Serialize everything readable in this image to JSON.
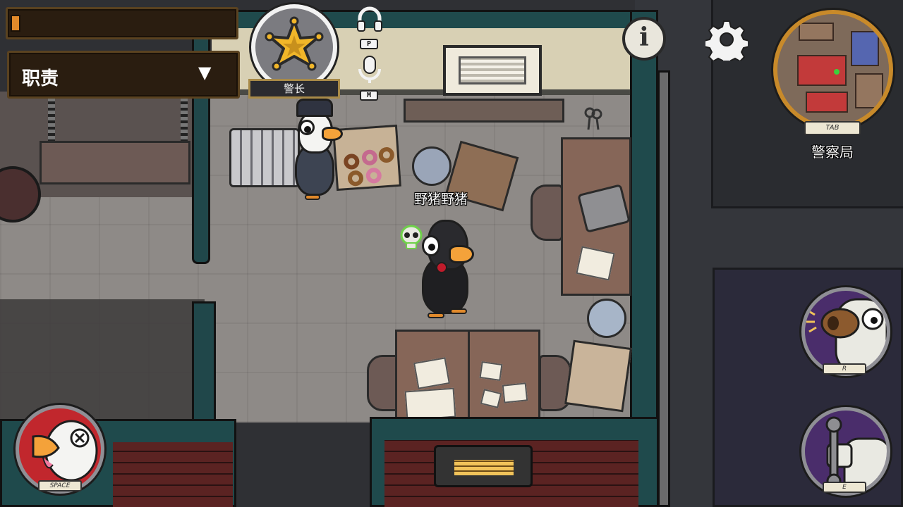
{
  "hud": {
    "task_progress": 0.04,
    "role_dropdown": {
      "label": "职责",
      "arrow": "▼"
    },
    "role_badge": {
      "label": "警长",
      "icon": "sheriff-star-icon"
    },
    "audio": {
      "speaker_key": "P",
      "mic_key": "M"
    },
    "info_button": {
      "glyph": "i"
    },
    "settings_icon": "gear-icon",
    "minimap": {
      "key": "TAB",
      "location": "警察局"
    },
    "abilities": {
      "report": {
        "key": "SPACE",
        "icon": "report-goose-icon"
      },
      "call": {
        "key": "R",
        "icon": "honk-goose-icon"
      },
      "use": {
        "key": "E",
        "icon": "wrench-icon"
      }
    }
  },
  "world": {
    "player_name": "野猪野猪"
  },
  "colors": {
    "progress_fill": "#e28a2a",
    "minimap_ring": "#c88a2a",
    "player_dot": "#3bd13b",
    "ability_ring_bg": "#4a2d6b",
    "report_bg": "#c1272d"
  }
}
